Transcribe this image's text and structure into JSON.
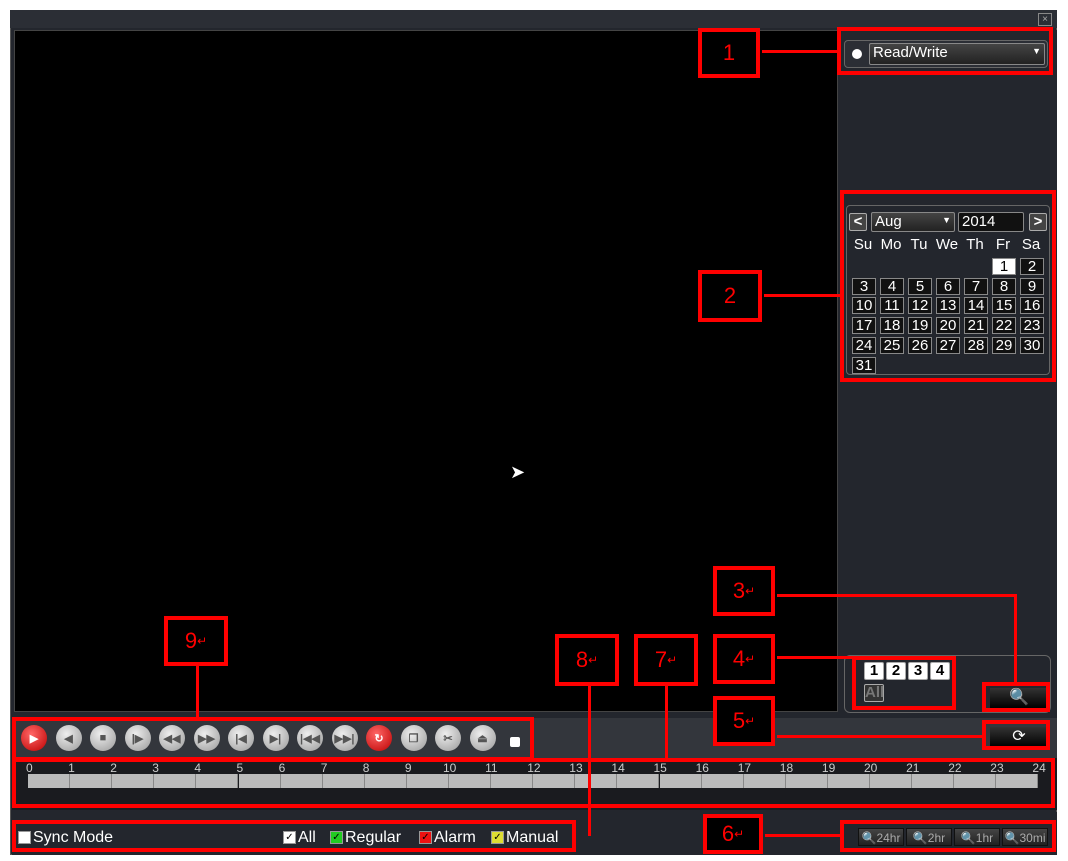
{
  "window": {
    "close": "×"
  },
  "mode": {
    "value": "Read/Write"
  },
  "calendar": {
    "prev": "<",
    "next": ">",
    "month": "Aug",
    "year": "2014",
    "weekdays": [
      "Su",
      "Mo",
      "Tu",
      "We",
      "Th",
      "Fr",
      "Sa"
    ],
    "days": [
      "1",
      "2",
      "3",
      "4",
      "5",
      "6",
      "7",
      "8",
      "9",
      "10",
      "11",
      "12",
      "13",
      "14",
      "15",
      "16",
      "17",
      "18",
      "19",
      "20",
      "21",
      "22",
      "23",
      "24",
      "25",
      "26",
      "27",
      "28",
      "29",
      "30",
      "31"
    ]
  },
  "channels": {
    "items": [
      "1",
      "2",
      "3",
      "4"
    ],
    "all": "All"
  },
  "controls": {
    "buttons": [
      "play",
      "slow-backward",
      "stop",
      "slow-play",
      "fast-backward",
      "fast-forward",
      "previous-frame",
      "next-frame",
      "previous-file",
      "next-file",
      "loop",
      "fullscreen",
      "clip",
      "backup"
    ]
  },
  "timeline": {
    "ticks": [
      "0",
      "1",
      "2",
      "3",
      "4",
      "5",
      "6",
      "7",
      "8",
      "9",
      "10",
      "11",
      "12",
      "13",
      "14",
      "15",
      "16",
      "17",
      "18",
      "19",
      "20",
      "21",
      "22",
      "23",
      "24"
    ]
  },
  "bottom": {
    "sync": "Sync Mode",
    "all": "All",
    "regular": "Regular",
    "alarm": "Alarm",
    "manual": "Manual",
    "colors": {
      "regular": "#22cc22",
      "alarm": "#ee1111",
      "manual": "#dddd33"
    }
  },
  "zoom": [
    "24hr",
    "2hr",
    "1hr",
    "30mi"
  ],
  "annotations": [
    "1",
    "2",
    "3",
    "4",
    "5",
    "6",
    "7",
    "8",
    "9"
  ],
  "marks": {
    "newline": "↵"
  }
}
